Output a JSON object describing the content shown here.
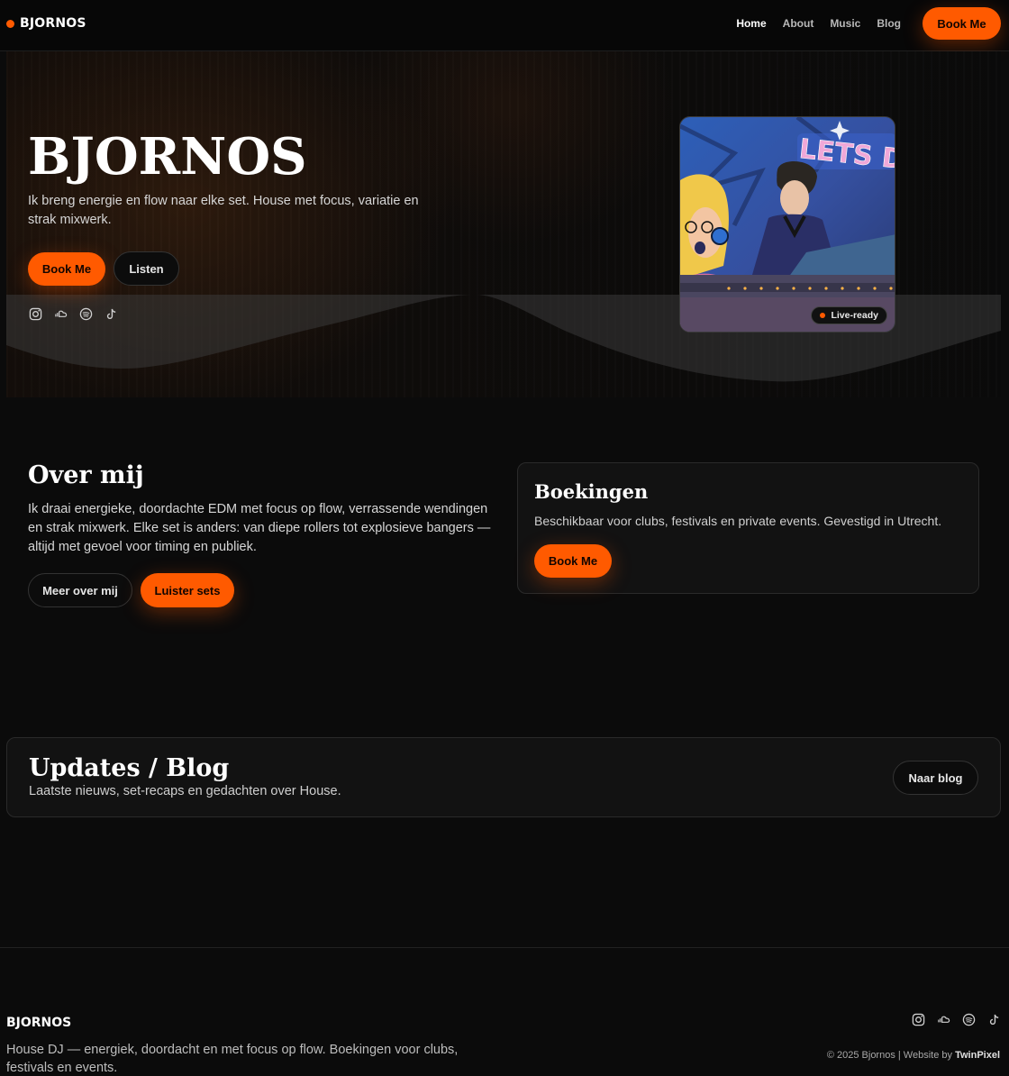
{
  "brand": {
    "name": "BJORNOS",
    "accent": "#ff5a00"
  },
  "nav": {
    "items": [
      {
        "label": "Home",
        "active": true
      },
      {
        "label": "About"
      },
      {
        "label": "Music"
      },
      {
        "label": "Blog"
      }
    ],
    "book_label": "Book Me"
  },
  "hero": {
    "title": "BJORNOS",
    "text": "Ik breng energie en flow naar elke set. House met focus, variatie en strak mixwerk.",
    "book_label": "Book Me",
    "listen_label": "Listen",
    "socials": [
      "instagram-icon",
      "soundcloud-icon",
      "spotify-icon",
      "tiktok-icon"
    ],
    "photo_badge": "Live-ready",
    "photo_sign": "LETS D"
  },
  "about": {
    "title": "Over mij",
    "text": "Ik draai energieke, doordachte EDM met focus op flow, verrassende wendingen en strak mixwerk. Elke set is anders: van diepe rollers tot explosieve bangers — altijd met gevoel voor timing en publiek.",
    "more_label": "Meer over mij",
    "listen_label": "Luister sets"
  },
  "booking": {
    "title": "Boekingen",
    "text": "Beschikbaar voor clubs, festivals en private events. Gevestigd in Utrecht.",
    "button_label": "Book Me"
  },
  "blog": {
    "title": "Updates / Blog",
    "subtitle": "Laatste nieuws, set-recaps en gedachten over House.",
    "button_label": "Naar blog"
  },
  "footer": {
    "logo": "BJORNOS",
    "text": "House DJ — energiek, doordacht en met focus op flow. Boekingen voor clubs, festivals en events.",
    "copyright": "© 2025 Bjornos | Website by ",
    "credit": "TwinPixel"
  }
}
